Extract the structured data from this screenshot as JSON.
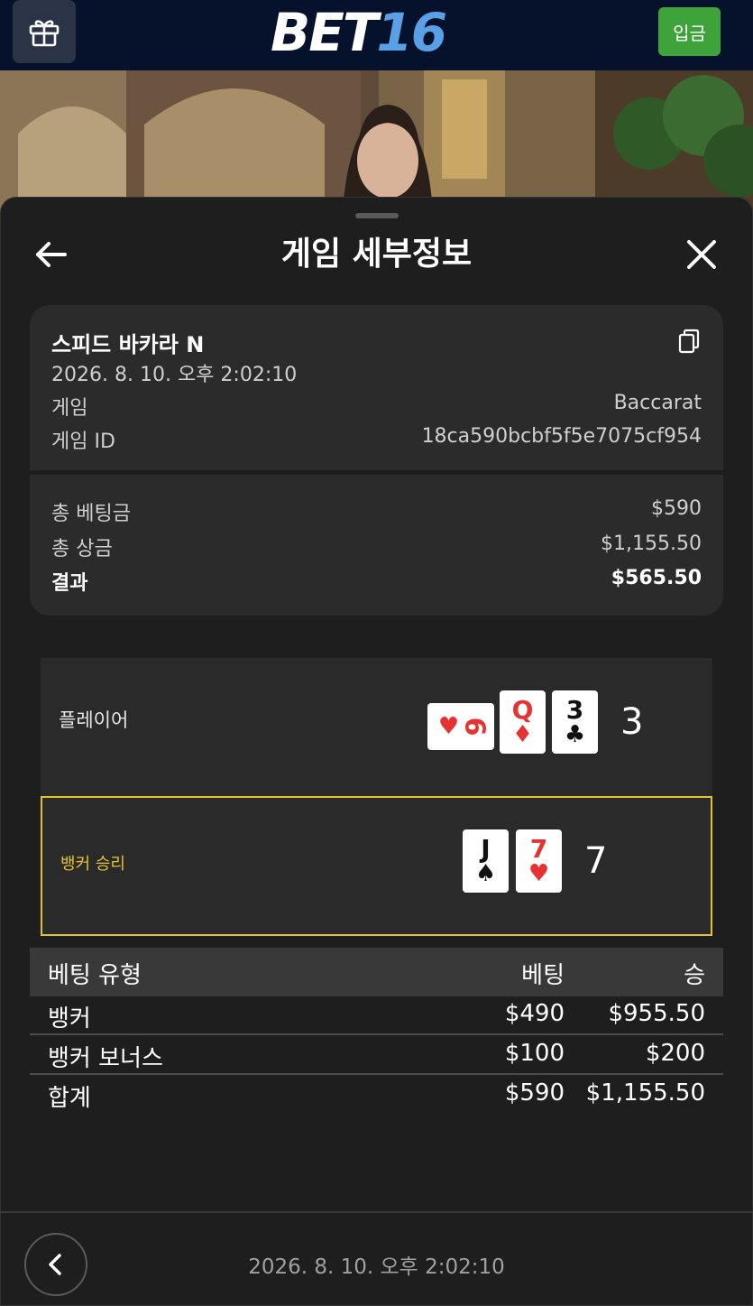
{
  "header": {
    "logo_part1": "BET",
    "logo_part2": "16",
    "deposit_label": "입금",
    "gift_icon": "gift-icon"
  },
  "sheet": {
    "title": "게임 세부정보",
    "back_icon": "arrow-left-icon",
    "close_icon": "close-icon"
  },
  "game_info": {
    "name": "스피드 바카라 N",
    "datetime": "2026. 8. 10. 오후 2:02:10",
    "game_label": "게임",
    "game_value": "Baccarat",
    "id_label": "게임 ID",
    "id_value": "18ca590bcbf5f5e7075cf954",
    "copy_icon": "copy-icon"
  },
  "summary": {
    "total_bet_label": "총 베팅금",
    "total_bet_value": "$590",
    "total_win_label": "총 상금",
    "total_win_value": "$1,155.50",
    "result_label": "결과",
    "result_value": "$565.50"
  },
  "hands": {
    "player": {
      "label": "플레이어",
      "score": "3",
      "cards": [
        {
          "rank": "6",
          "suit": "♥",
          "color": "red",
          "rotated": true
        },
        {
          "rank": "Q",
          "suit": "♦",
          "color": "red"
        },
        {
          "rank": "3",
          "suit": "♣",
          "color": "black"
        }
      ]
    },
    "banker": {
      "label": "뱅커 승리",
      "score": "7",
      "highlight_color": "#e2c230",
      "cards": [
        {
          "rank": "J",
          "suit": "♠",
          "color": "black"
        },
        {
          "rank": "7",
          "suit": "♥",
          "color": "red"
        }
      ]
    }
  },
  "bets_table": {
    "headers": [
      "베팅 유형",
      "베팅",
      "승"
    ],
    "rows": [
      [
        "뱅커",
        "$490",
        "$955.50"
      ],
      [
        "뱅커 보너스",
        "$100",
        "$200"
      ],
      [
        "합계",
        "$590",
        "$1,155.50"
      ]
    ]
  },
  "footer": {
    "datetime": "2026. 8. 10. 오후 2:02:10",
    "prev_icon": "chevron-left-icon"
  },
  "colors": {
    "topbar": "#06122b",
    "deposit": "#3fa33c",
    "logo_accent": "#5aa0e6",
    "banker_highlight": "#e2c230"
  }
}
